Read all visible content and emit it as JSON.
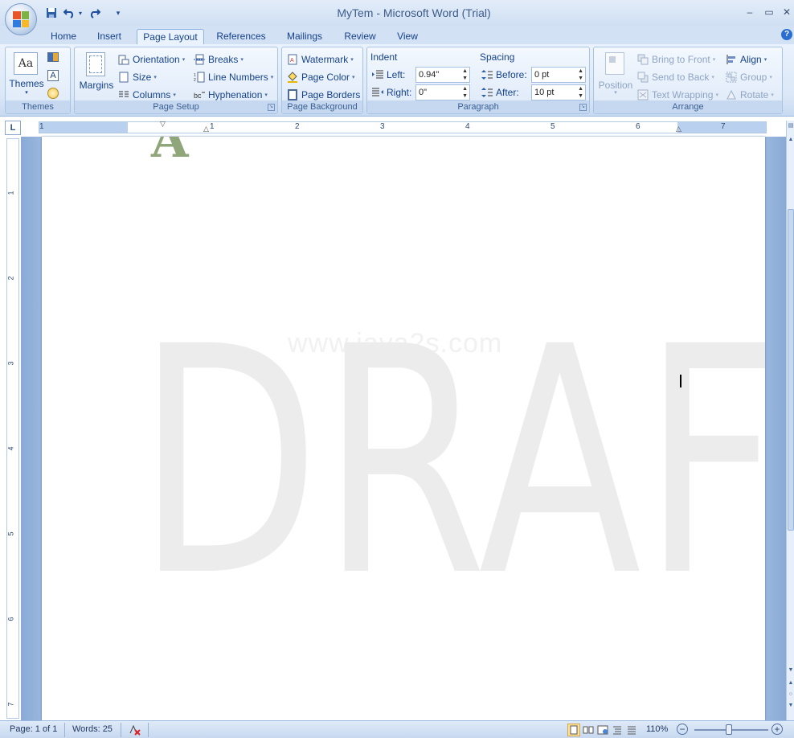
{
  "window": {
    "title": "MyTem - Microsoft Word (Trial)",
    "minimize_glyph": "–",
    "maximize_glyph": "▭",
    "close_glyph": "✕"
  },
  "quick_access": {
    "save_icon": "save-icon",
    "undo_icon": "undo-icon",
    "redo_icon": "redo-icon",
    "customize_glyph": "▾"
  },
  "tabs": [
    {
      "label": "Home"
    },
    {
      "label": "Insert"
    },
    {
      "label": "Page Layout",
      "active": true
    },
    {
      "label": "References"
    },
    {
      "label": "Mailings"
    },
    {
      "label": "Review"
    },
    {
      "label": "View"
    }
  ],
  "help_glyph": "?",
  "ribbon": {
    "themes": {
      "label": "Themes",
      "themes_button": "Themes",
      "thumb_text": "Aa"
    },
    "page_setup": {
      "label": "Page Setup",
      "margins": "Margins",
      "orientation": "Orientation",
      "size": "Size",
      "columns": "Columns",
      "breaks": "Breaks",
      "line_numbers": "Line Numbers",
      "hyphenation": "Hyphenation"
    },
    "page_background": {
      "label": "Page Background",
      "watermark": "Watermark",
      "page_color": "Page Color",
      "page_borders": "Page Borders"
    },
    "paragraph": {
      "label": "Paragraph",
      "indent_header": "Indent",
      "left_label": "Left:",
      "left_value": "0.94\"",
      "right_label": "Right:",
      "right_value": "0\"",
      "spacing_header": "Spacing",
      "before_label": "Before:",
      "before_value": "0 pt",
      "after_label": "After:",
      "after_value": "10 pt"
    },
    "arrange": {
      "label": "Arrange",
      "position": "Position",
      "bring_to_front": "Bring to Front",
      "send_to_back": "Send to Back",
      "text_wrapping": "Text Wrapping",
      "align": "Align",
      "group": "Group",
      "rotate": "Rotate"
    }
  },
  "ruler": {
    "corner_glyph": "L",
    "h_numbers": [
      "1",
      "1",
      "2",
      "3",
      "4",
      "5",
      "6",
      "7"
    ],
    "v_numbers": [
      "1",
      "2",
      "3",
      "4",
      "5",
      "6",
      "7"
    ]
  },
  "document": {
    "watermark_text": "DRAFT",
    "watermark_subtext": "www.java2s.com",
    "top_letter": "A"
  },
  "status": {
    "page": "Page: 1 of 1",
    "words": "Words: 25",
    "zoom": "110%",
    "zoom_minus": "−",
    "zoom_plus": "+"
  },
  "colors": {
    "accent": "#15428b",
    "ribbon_bg": "#dbe8f7",
    "watermark": "#ececec"
  }
}
